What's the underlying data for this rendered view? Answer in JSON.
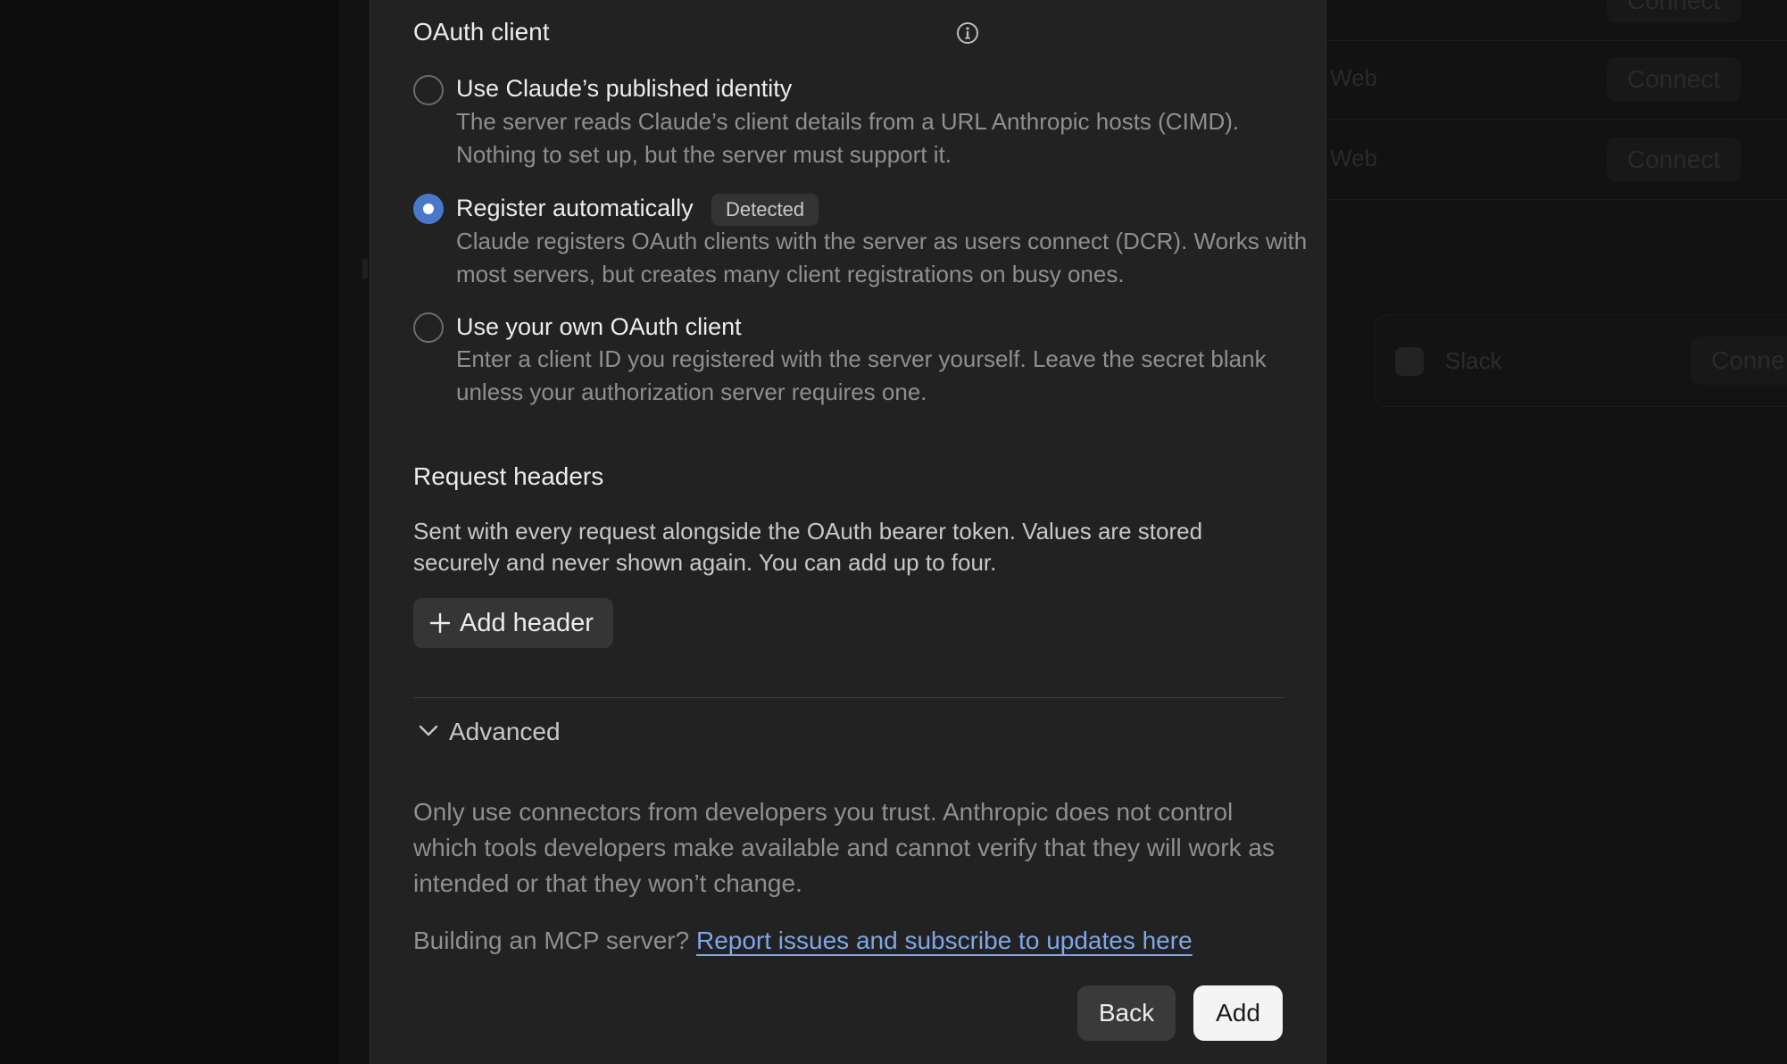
{
  "background": {
    "rows": [
      {
        "label": "",
        "button": "Connect"
      },
      {
        "label": "Web",
        "button": "Connect"
      },
      {
        "label": "Web",
        "button": "Connect"
      }
    ],
    "card": {
      "label": "Slack",
      "button": "Conne"
    }
  },
  "oauth": {
    "title": "OAuth client",
    "options": [
      {
        "label": "Use Claude’s published identity",
        "desc": "The server reads Claude’s client details from a URL Anthropic hosts (CIMD). Nothing to set up, but the server must support it.",
        "checked": false
      },
      {
        "label": "Register automatically",
        "badge": "Detected",
        "desc": "Claude registers OAuth clients with the server as users connect (DCR). Works with most servers, but creates many client registrations on busy ones.",
        "checked": true
      },
      {
        "label": "Use your own OAuth client",
        "desc": "Enter a client ID you registered with the server yourself. Leave the secret blank unless your authorization server requires one.",
        "checked": false
      }
    ]
  },
  "headers": {
    "title": "Request headers",
    "desc": "Sent with every request alongside the OAuth bearer token. Values are stored securely and never shown again. You can add up to four.",
    "add_label": "Add header"
  },
  "advanced": {
    "label": "Advanced"
  },
  "warning": "Only use connectors from developers you trust. Anthropic does not control which tools developers make available and cannot verify that they will work as intended or that they won’t change.",
  "mcp": {
    "prefix": "Building an MCP server?",
    "link": "Report issues and subscribe to updates here"
  },
  "footer": {
    "back": "Back",
    "add": "Add"
  },
  "colors": {
    "accent": "#4a78c9",
    "link": "#7ea6e8",
    "modal_bg": "#222222"
  }
}
